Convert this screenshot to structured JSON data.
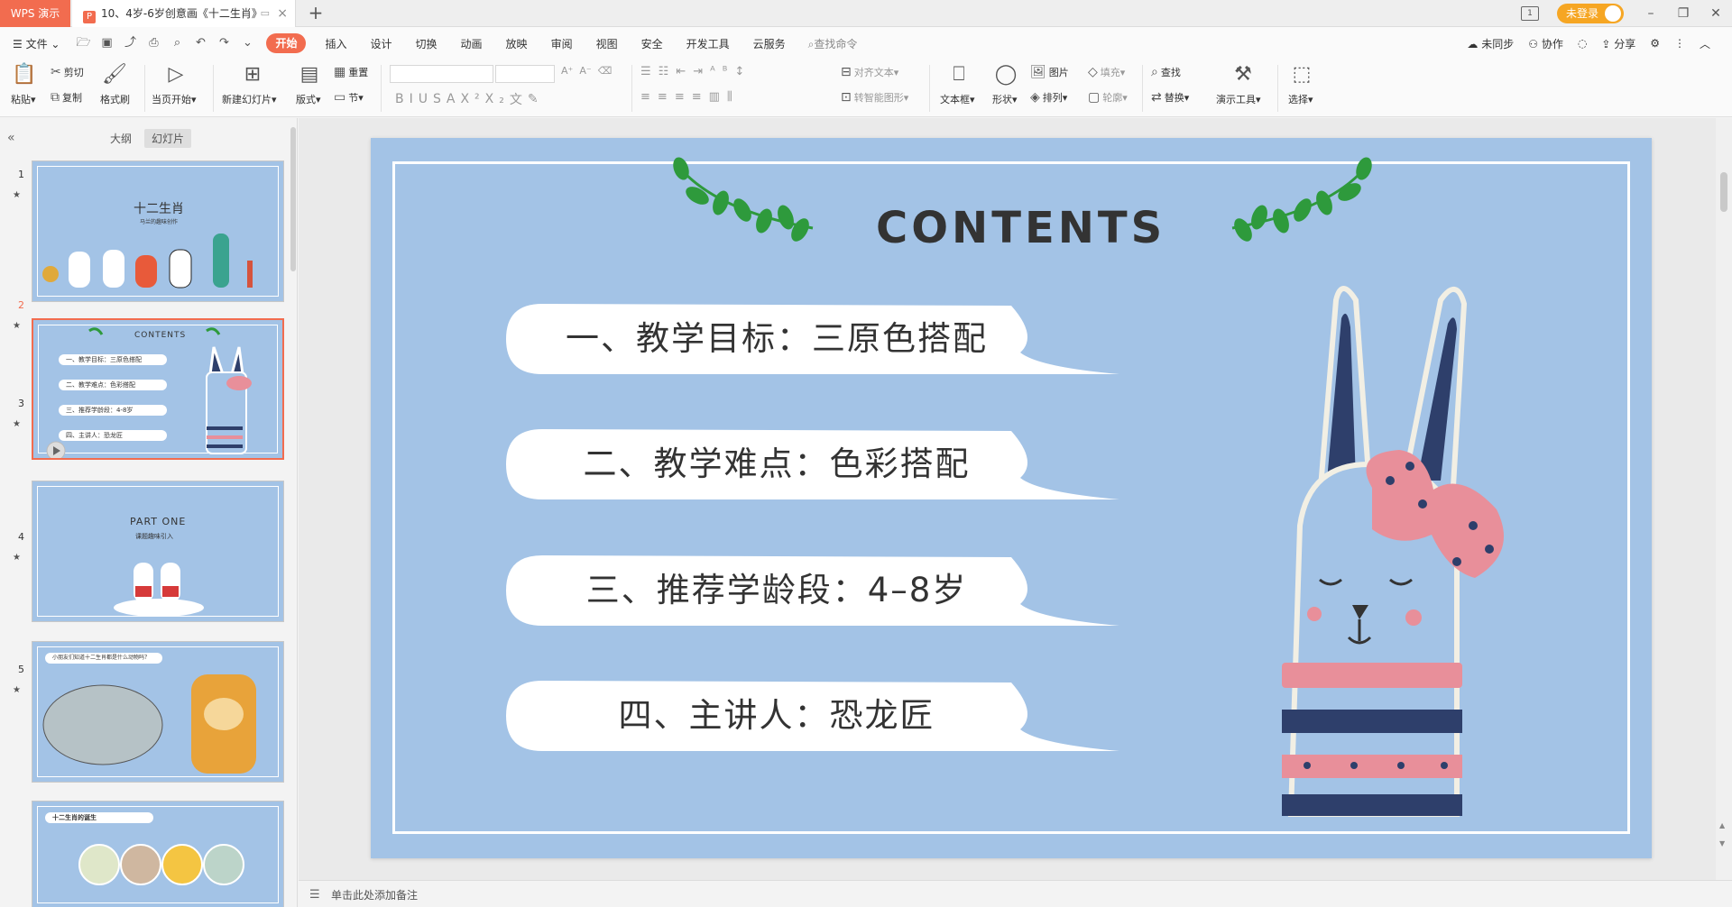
{
  "titlebar": {
    "app_tab": "WPS 演示",
    "doc_tab": "10、4岁-6岁创意画《十二生肖》",
    "new_tab_label": "+",
    "login_label": "未登录",
    "layout_btn": "1"
  },
  "menubar": {
    "file_label": "文件",
    "tabs": [
      "开始",
      "插入",
      "设计",
      "切换",
      "动画",
      "放映",
      "审阅",
      "视图",
      "安全",
      "开发工具",
      "云服务"
    ],
    "search_placeholder": "查找命令",
    "right": {
      "sync": "未同步",
      "collab": "协作",
      "share": "分享"
    }
  },
  "ribbon": {
    "paste": "粘贴",
    "cut": "剪切",
    "copy": "复制",
    "format_painter": "格式刷",
    "from_current": "当页开始",
    "new_slide": "新建幻灯片",
    "layout": "版式",
    "reset": "重置",
    "section": "节",
    "align_text": "对齐文本",
    "smart_shape": "转智能图形",
    "textbox": "文本框",
    "shape": "形状",
    "picture": "图片",
    "arrange": "排列",
    "fill": "填充",
    "outline": "轮廓",
    "find": "查找",
    "replace": "替换",
    "present_tools": "演示工具",
    "select": "选择"
  },
  "leftpanel": {
    "tab_outline": "大纲",
    "tab_slides": "幻灯片",
    "thumbs": [
      {
        "num": "1",
        "title": "十二生肖",
        "subtitle": "马兰的趣味创作"
      },
      {
        "num": "2",
        "title": "CONTENTS",
        "items": [
          "一、教学目标：三原色搭配",
          "二、教学难点：色彩搭配",
          "三、推荐学龄段：4-8岁",
          "四、主讲人：恐龙匠"
        ]
      },
      {
        "num": "3",
        "title": "PART ONE",
        "subtitle": "课题趣味引入"
      },
      {
        "num": "4",
        "title": "小朋友们知道十二生肖都是什么动物吗？"
      },
      {
        "num": "5",
        "title": "十二生肖的诞生"
      }
    ]
  },
  "slide": {
    "title": "CONTENTS",
    "items": [
      "一、教学目标：三原色搭配",
      "二、教学难点：色彩搭配",
      "三、推荐学龄段：4–8岁",
      "四、主讲人：恐龙匠"
    ]
  },
  "notes": {
    "placeholder": "单击此处添加备注"
  },
  "colors": {
    "accent": "#f26c4f",
    "slide_bg": "#a3c3e6",
    "bunny_navy": "#2e3f6b",
    "bunny_pink": "#e88f9a",
    "leaf_green": "#2e9a3c"
  }
}
